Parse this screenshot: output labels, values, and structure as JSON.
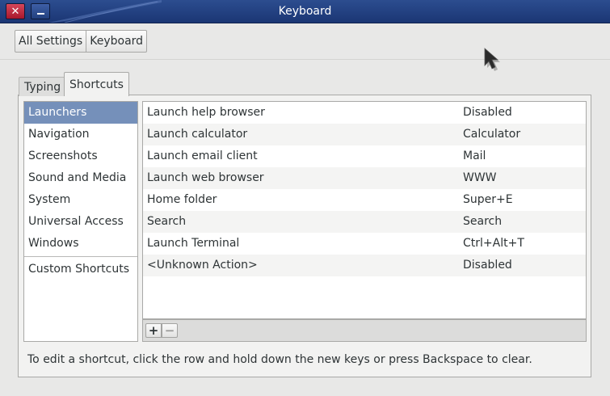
{
  "window": {
    "title": "Keyboard",
    "close_glyph": "✕",
    "minimize_icon": "minimize-icon"
  },
  "breadcrumb": {
    "items": [
      "All Settings",
      "Keyboard"
    ]
  },
  "tabs": [
    "Typing",
    "Shortcuts"
  ],
  "selected_tab": "Shortcuts",
  "categories": {
    "items": [
      "Launchers",
      "Navigation",
      "Screenshots",
      "Sound and Media",
      "System",
      "Universal Access",
      "Windows"
    ],
    "custom": "Custom Shortcuts",
    "selected": "Launchers",
    "selected_color": "#7590ba"
  },
  "shortcuts": [
    {
      "name": "Launch help browser",
      "key": "Disabled"
    },
    {
      "name": "Launch calculator",
      "key": "Calculator"
    },
    {
      "name": "Launch email client",
      "key": "Mail"
    },
    {
      "name": "Launch web browser",
      "key": "WWW"
    },
    {
      "name": "Home folder",
      "key": "Super+E"
    },
    {
      "name": "Search",
      "key": "Search"
    },
    {
      "name": "Launch Terminal",
      "key": "Ctrl+Alt+T"
    },
    {
      "name": "<Unknown Action>",
      "key": "Disabled"
    }
  ],
  "list_toolbar": {
    "add": "+",
    "remove": "−"
  },
  "hint": "To edit a shortcut, click the row and hold down the new keys or press Backspace to clear.",
  "colors": {
    "titlebar": "#1b3674",
    "close_button": "#c0283b"
  }
}
